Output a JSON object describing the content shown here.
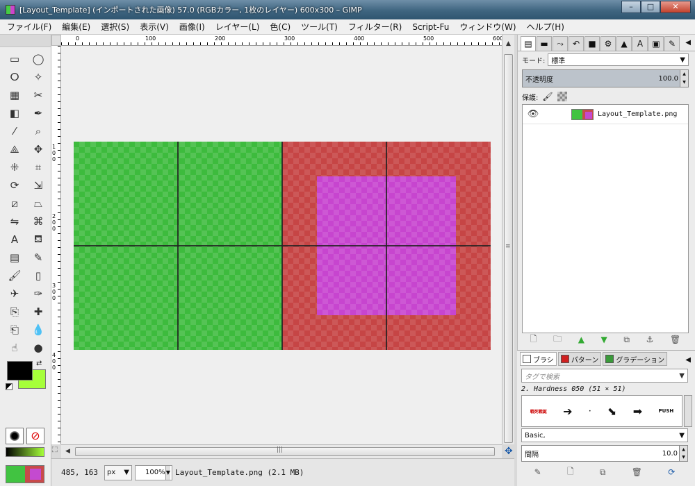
{
  "window": {
    "title": "[Layout_Template] (インポートされた画像) 57.0 (RGBカラー, 1枚のレイヤー) 600x300 – GIMP",
    "minimize_glyph": "–",
    "maximize_glyph": "□",
    "close_glyph": "✕"
  },
  "menubar": {
    "items": [
      "ファイル(F)",
      "編集(E)",
      "選択(S)",
      "表示(V)",
      "画像(I)",
      "レイヤー(L)",
      "色(C)",
      "ツール(T)",
      "フィルター(R)",
      "Script-Fu",
      "ウィンドウ(W)",
      "ヘルプ(H)"
    ]
  },
  "toolbox": {
    "tools": [
      {
        "name": "rect-select-icon",
        "glyph": "▭"
      },
      {
        "name": "ellipse-select-icon",
        "glyph": "◯"
      },
      {
        "name": "free-select-icon",
        "glyph": "ⵔ"
      },
      {
        "name": "fuzzy-select-icon",
        "glyph": "✧"
      },
      {
        "name": "color-select-icon",
        "glyph": "▦"
      },
      {
        "name": "scissors-icon",
        "glyph": "✂"
      },
      {
        "name": "foreground-select-icon",
        "glyph": "◧"
      },
      {
        "name": "paths-icon",
        "glyph": "✒"
      },
      {
        "name": "color-picker-icon",
        "glyph": "⁄"
      },
      {
        "name": "zoom-icon",
        "glyph": "⌕"
      },
      {
        "name": "measure-icon",
        "glyph": "⟁"
      },
      {
        "name": "move-icon",
        "glyph": "✥"
      },
      {
        "name": "align-icon",
        "glyph": "⁜"
      },
      {
        "name": "crop-icon",
        "glyph": "⌗"
      },
      {
        "name": "rotate-icon",
        "glyph": "⟳"
      },
      {
        "name": "scale-icon",
        "glyph": "⇲"
      },
      {
        "name": "shear-icon",
        "glyph": "⧄"
      },
      {
        "name": "perspective-icon",
        "glyph": "⏢"
      },
      {
        "name": "flip-icon",
        "glyph": "⇋"
      },
      {
        "name": "cage-icon",
        "glyph": "⌘"
      },
      {
        "name": "text-icon",
        "glyph": "A"
      },
      {
        "name": "bucket-fill-icon",
        "glyph": "⛾"
      },
      {
        "name": "blend-icon",
        "glyph": "▤"
      },
      {
        "name": "pencil-icon",
        "glyph": "✎"
      },
      {
        "name": "paintbrush-icon",
        "glyph": "🖌"
      },
      {
        "name": "eraser-icon",
        "glyph": "▯"
      },
      {
        "name": "airbrush-icon",
        "glyph": "✈"
      },
      {
        "name": "ink-icon",
        "glyph": "✑"
      },
      {
        "name": "clone-icon",
        "glyph": "⎘"
      },
      {
        "name": "heal-icon",
        "glyph": "✚"
      },
      {
        "name": "perspective-clone-icon",
        "glyph": "⎗"
      },
      {
        "name": "blur-icon",
        "glyph": "💧"
      },
      {
        "name": "smudge-icon",
        "glyph": "☝"
      },
      {
        "name": "dodge-burn-icon",
        "glyph": "●"
      }
    ]
  },
  "rulers": {
    "h_labels": [
      "0",
      "100",
      "200",
      "300",
      "400",
      "500",
      "600"
    ],
    "v_labels": [
      "1 0 0",
      "2 0 0",
      "3 0 0",
      "4 0 0"
    ]
  },
  "statusbar": {
    "coords": "485, 163",
    "unit": "px",
    "zoom": "100%",
    "text": "Layout_Template.png (2.1 MB)"
  },
  "layers_dock": {
    "tabs": [
      "layers-icon",
      "channels-icon",
      "paths-dock-icon",
      "undo-icon",
      "colors-icon",
      "tool-options-icon",
      "histogram-icon",
      "fonts-icon",
      "images-icon",
      "brushes-dock-icon"
    ],
    "mode_label": "モード:",
    "mode_value": "標準",
    "opacity_label": "不透明度",
    "opacity_value": "100.0",
    "lock_label": "保護:",
    "layers": [
      {
        "name": "Layout_Template.png"
      }
    ]
  },
  "brushes_dock": {
    "tabs": [
      {
        "label": "ブラシ",
        "swatch": "#ffffff"
      },
      {
        "label": "パターン",
        "swatch": "#d02020"
      },
      {
        "label": "グラデーション",
        "swatch": "#3a9a3a"
      }
    ],
    "tag_placeholder": "タグで検索",
    "current_brush": "2. Hardness 050 (51 × 51)",
    "brush_texts": [
      "戦死戦誕",
      "PUSH"
    ],
    "preset": "Basic,",
    "spacing_label": "間隔",
    "spacing_value": "10.0"
  },
  "colors": {
    "fg": "#000000",
    "bg": "#a6ff3a",
    "green": "#3dbb3d",
    "red": "#c64545",
    "magenta": "#c745cf"
  }
}
